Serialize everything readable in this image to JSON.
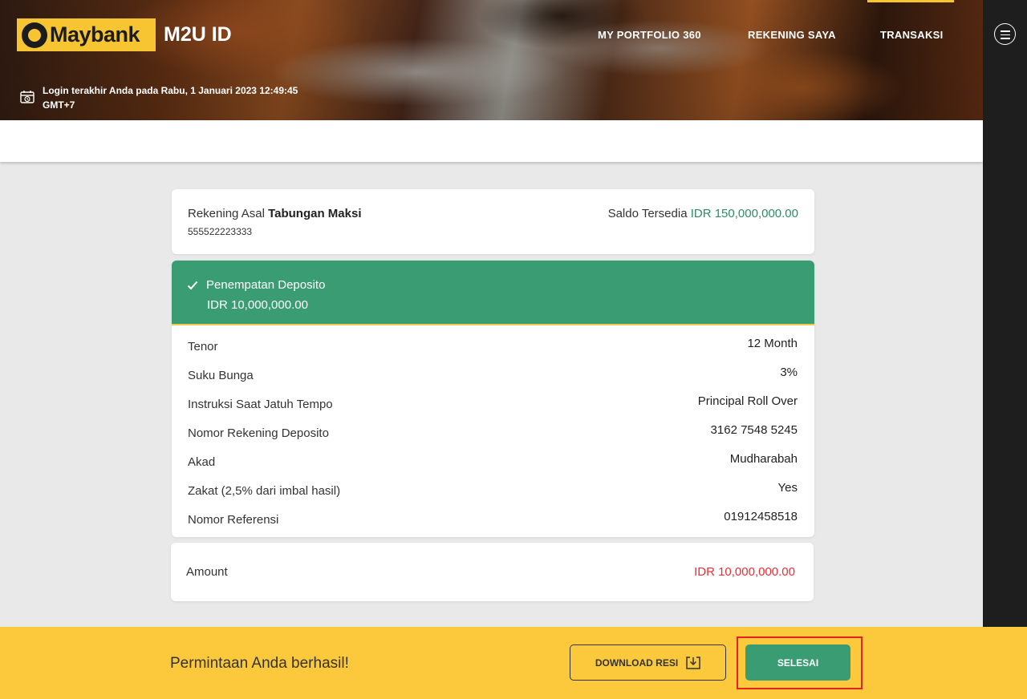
{
  "header": {
    "brand": "Maybank",
    "app_name": "M2U ID",
    "nav": [
      "MY PORTFOLIO 360",
      "REKENING SAYA",
      "TRANSAKSI"
    ],
    "last_login_line1": "Login terakhir Anda pada Rabu, 1 Januari 2023 12:49:45",
    "last_login_line2": "GMT+7"
  },
  "account": {
    "label": "Rekening Asal",
    "name": "Tabungan Maksi",
    "number": "555522223333",
    "balance_label": "Saldo Tersedia",
    "balance": "IDR 150,000,000.00"
  },
  "result": {
    "title": "Penempatan Deposito",
    "amount": "IDR 10,000,000.00",
    "rows": [
      {
        "label": "Tenor",
        "value": "12 Month"
      },
      {
        "label": "Suku Bunga",
        "value": "3%"
      },
      {
        "label": "Instruksi Saat Jatuh Tempo",
        "value": "Principal Roll Over"
      },
      {
        "label": "Nomor Rekening Deposito",
        "value": "3162 7548 5245"
      },
      {
        "label": "Akad",
        "value": "Mudharabah"
      },
      {
        "label": "Zakat (2,5% dari imbal hasil)",
        "value": "Yes"
      },
      {
        "label": "Nomor Referensi",
        "value": "01912458518"
      }
    ]
  },
  "amount_summary": {
    "label": "Amount",
    "value": "IDR 10,000,000.00"
  },
  "footer": {
    "message": "Permintaan Anda berhasil!",
    "download_label": "DOWNLOAD RESI",
    "done_label": "SELESAI"
  },
  "colors": {
    "brand_yellow": "#fdc93c",
    "success_green": "#3a9c72",
    "balance_green": "#2e8b62",
    "amount_red": "#e0303a",
    "highlight_red": "#e32222"
  },
  "icons": [
    "calendar-clock-icon",
    "menu-icon",
    "check-icon",
    "download-icon"
  ]
}
